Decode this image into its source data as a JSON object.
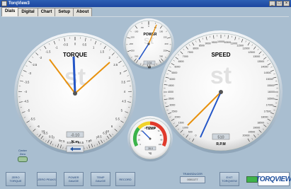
{
  "window": {
    "title": "TorqView3",
    "controls": [
      "_",
      "□",
      "×"
    ]
  },
  "tabs": [
    {
      "label": "Dials"
    },
    {
      "label": "Digital"
    },
    {
      "label": "Chart"
    },
    {
      "label": "Setup"
    },
    {
      "label": "About"
    }
  ],
  "torque": {
    "title": "TORQUE",
    "unit": "N.m",
    "value": "-0.10",
    "ticks": [
      "0",
      "0.5",
      "1",
      "1.5",
      "2",
      "2.5",
      "3",
      "3.5",
      "4",
      "4.5",
      "5",
      "5.5",
      "6",
      "6.5",
      "7",
      "7.5",
      "8",
      "8.5",
      "9",
      "9.5",
      "10",
      "-0.5",
      "-1",
      "-1.5",
      "-2",
      "-2.5",
      "-3",
      "-3.5",
      "-4",
      "-4.5",
      "-5",
      "-5.5",
      "-6",
      "-6.5",
      "-7",
      "-7.5",
      "-8",
      "-8.5",
      "-9",
      "-9.5",
      "-10"
    ]
  },
  "power": {
    "title": "POWER",
    "unit": "W",
    "value": "0.34",
    "ticks": [
      "100",
      "150",
      "200",
      "250",
      "300",
      "50",
      "0",
      "-50",
      "-100",
      "-150",
      "-200",
      "-250",
      "-300"
    ]
  },
  "speed": {
    "title": "SPEED",
    "unit": "R.P.M",
    "value": "510",
    "ticks": [
      "0",
      "500",
      "1000",
      "1500",
      "2000",
      "2500",
      "3000",
      "3500",
      "4000",
      "4500",
      "5000",
      "5500",
      "6000",
      "6500",
      "7000",
      "7500",
      "8000",
      "8500",
      "9000",
      "9500",
      "10000",
      "10500",
      "11000",
      "11500",
      "12000",
      "12500",
      "13000",
      "13500",
      "14000",
      "14500",
      "15000",
      "15500",
      "16000",
      "16500",
      "17000",
      "17500",
      "18000",
      "18500",
      "19000",
      "19500",
      "20000"
    ]
  },
  "temp": {
    "title": "TEMP",
    "unit": "°C",
    "value": "28.0",
    "ticks": [
      "0",
      "10",
      "20",
      "30",
      "40",
      "50",
      "60",
      "70",
      "80",
      "90",
      "100"
    ]
  },
  "center_zero": {
    "label": "Center Zero"
  },
  "buttons": {
    "zero_torque": "ZERO TORQUE",
    "zero_peaks": "ZERO PEAKS",
    "power_gauge": "POWER GAUGE",
    "temp_gauge": "TEMP GAUGE",
    "record": "RECORD",
    "exit": "EXIT TORQVIEW"
  },
  "transducer": {
    "label": "TRANSDUCER",
    "value": "0001177"
  },
  "logo": "TORQVIEW",
  "colors": {
    "accent": "#1f4f9c",
    "needle_primary": "#2456c7",
    "needle_secondary": "#e8920f",
    "background": "#a9bed0"
  }
}
